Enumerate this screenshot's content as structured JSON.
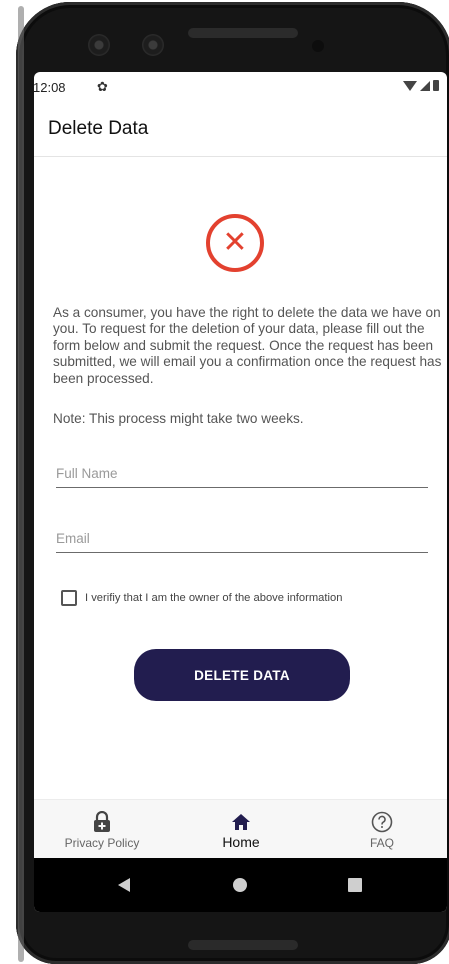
{
  "status_bar": {
    "time": "12:08",
    "icons": [
      "gear-icon",
      "wifi-icon",
      "signal-icon",
      "battery-icon"
    ]
  },
  "app_bar": {
    "title": "Delete Data"
  },
  "hero_icon": {
    "name": "error-x-icon",
    "color": "#e3412f"
  },
  "body": {
    "description": "As a consumer, you have the right to delete the data we have on you. To request for the deletion of your data, please fill out the form below and submit the request. Once the request has been submitted, we will email you a confirmation once the request has been processed.",
    "note": "Note: This process might take two weeks."
  },
  "form": {
    "full_name": {
      "placeholder": "Full Name",
      "value": ""
    },
    "email": {
      "placeholder": "Email",
      "value": ""
    },
    "verify_checkbox": {
      "label": "I verifiy that I am the owner of the above information",
      "checked": false
    },
    "submit_label": "DELETE DATA"
  },
  "bottom_nav": {
    "items": [
      {
        "label": "Privacy Policy",
        "icon": "lock-icon",
        "active": false
      },
      {
        "label": "Home",
        "icon": "home-icon",
        "active": true
      },
      {
        "label": "FAQ",
        "icon": "help-circle-icon",
        "active": false
      }
    ]
  },
  "system_nav": [
    "back-icon",
    "home-circle-icon",
    "recents-icon"
  ],
  "colors": {
    "accent": "#221d4f",
    "error": "#e3412f",
    "text": "#555555"
  }
}
